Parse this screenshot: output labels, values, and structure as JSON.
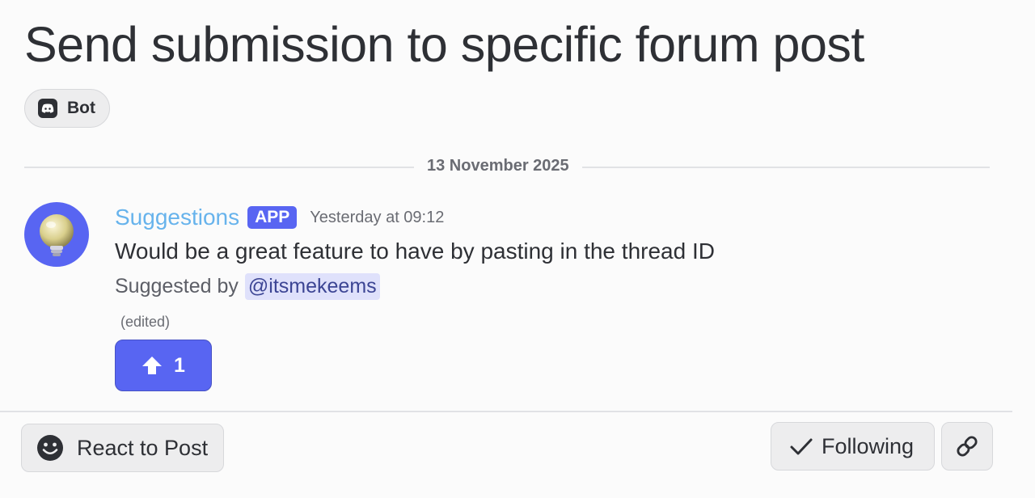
{
  "post": {
    "title": "Send submission to specific forum post",
    "tag": {
      "label": "Bot",
      "icon": "discord-icon"
    }
  },
  "divider": {
    "date": "13 November 2025"
  },
  "message": {
    "author": "Suggestions",
    "badge": "APP",
    "timestamp": "Yesterday at 09:12",
    "text": "Would be a great feature to have by pasting in the thread ID",
    "suggested_by_label": "Suggested by",
    "mention": "@itsmekeems",
    "edited": "(edited)",
    "avatar_icon": "lightbulb-icon",
    "reaction": {
      "icon": "arrow-up-icon",
      "count": "1"
    }
  },
  "footer": {
    "react_label": "React to Post",
    "react_icon": "smiley-icon",
    "following_label": "Following",
    "following_icon": "checkmark-icon",
    "link_icon": "link-icon"
  },
  "colors": {
    "accent": "#5865f2",
    "author": "#67b3ec",
    "mention_bg": "#dfe1fb",
    "mention_text": "#3c4594"
  }
}
